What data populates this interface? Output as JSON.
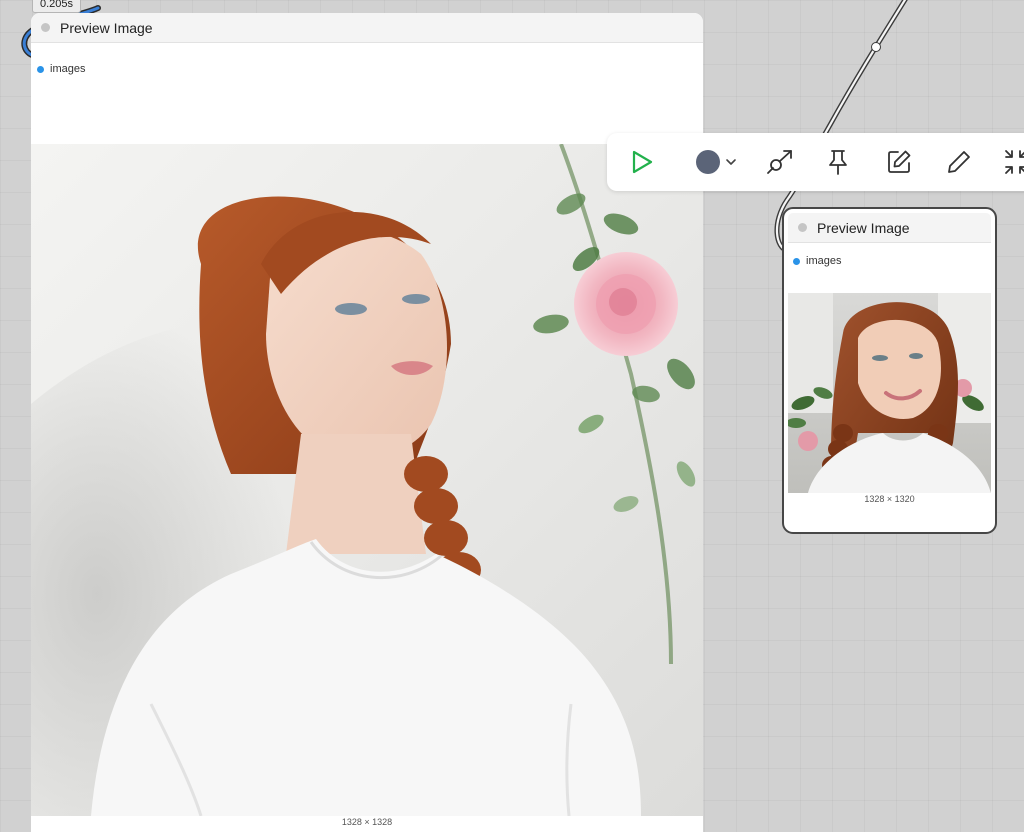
{
  "timing_badge": "0.205s",
  "node_large": {
    "title": "Preview Image",
    "slot_label": "images",
    "image_dimensions": "1328 × 1328",
    "image_alt": "Red-haired woman with braid in white t-shirt leaning against a white wall beside a pink rose"
  },
  "node_small": {
    "title": "Preview Image",
    "slot_label": "images",
    "image_dimensions": "1328 × 1320",
    "image_alt": "Smiling red-haired woman with braids in white t-shirt, rose vine in background"
  },
  "toolbar": {
    "items": [
      {
        "name": "run-button",
        "icon": "play-icon"
      },
      {
        "name": "color-button",
        "icon": "color-circle-icon",
        "color": "#5b6478"
      },
      {
        "name": "bypass-button",
        "icon": "bypass-icon"
      },
      {
        "name": "pin-button",
        "icon": "pin-icon"
      },
      {
        "name": "edit-button",
        "icon": "edit-square-icon"
      },
      {
        "name": "rename-button",
        "icon": "pencil-icon"
      },
      {
        "name": "collapse-button",
        "icon": "collapse-icon"
      }
    ]
  },
  "colors": {
    "canvas": "#d1d1d1",
    "run_icon": "#22b14c",
    "slot_dot": "#2a93e8",
    "link_outline": "#3b3b3b",
    "selected_link": "#3a7fd5"
  }
}
